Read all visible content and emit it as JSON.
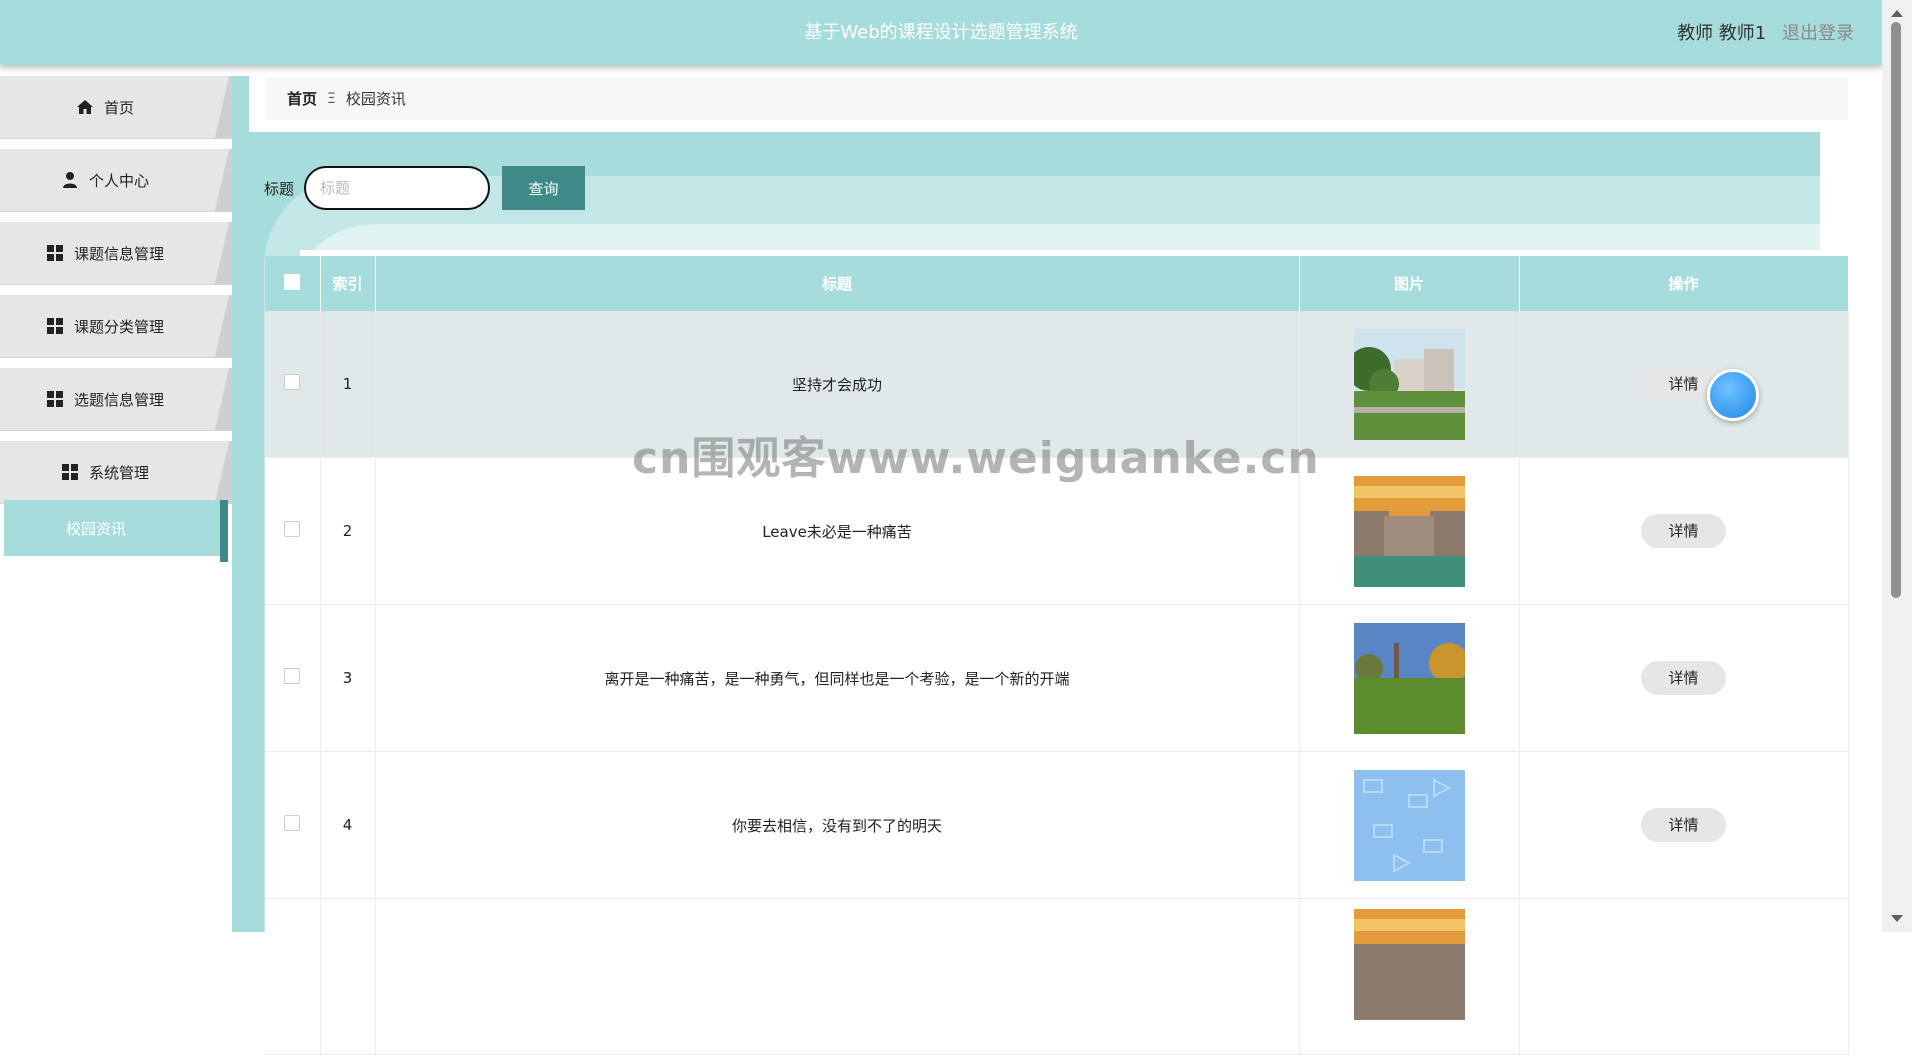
{
  "header": {
    "title": "基于Web的课程设计选题管理系统",
    "user_label": "教师 教师1",
    "logout_label": "退出登录"
  },
  "sidebar": {
    "items": [
      {
        "label": "首页",
        "icon": "home-icon"
      },
      {
        "label": "个人中心",
        "icon": "user-icon"
      },
      {
        "label": "课题信息管理",
        "icon": "grid-icon"
      },
      {
        "label": "课题分类管理",
        "icon": "grid-icon"
      },
      {
        "label": "选题信息管理",
        "icon": "grid-icon"
      },
      {
        "label": "系统管理",
        "icon": "grid-icon"
      },
      {
        "label": "校园资讯",
        "icon": "",
        "active": true
      }
    ]
  },
  "breadcrumb": {
    "home": "首页",
    "separator_icon": "menu-icon",
    "separator": "Ξ",
    "current": "校园资讯"
  },
  "search": {
    "label": "标题",
    "placeholder": "标题",
    "value": "",
    "button_label": "查询"
  },
  "table": {
    "headers": [
      "索引",
      "标题",
      "图片",
      "操作"
    ],
    "rows": [
      {
        "index": "1",
        "title": "坚持才会成功",
        "image": "campus-building-photo",
        "action": "详情"
      },
      {
        "index": "2",
        "title": "Leave未必是一种痛苦",
        "image": "campus-sunset-photo",
        "action": "详情"
      },
      {
        "index": "3",
        "title": "离开是一种痛苦，是一种勇气，但同样也是一个考验，是一个新的开端",
        "image": "campus-lawn-photo",
        "action": "详情"
      },
      {
        "index": "4",
        "title": "你要去相信，没有到不了的明天",
        "image": "school-pattern-image",
        "action": "详情"
      }
    ]
  },
  "watermark": "cn围观客www.weiguanke.cn",
  "colors": {
    "primary": "#a6dcdb",
    "button": "#3e8a88",
    "row_hover": "#dfe9e9"
  }
}
